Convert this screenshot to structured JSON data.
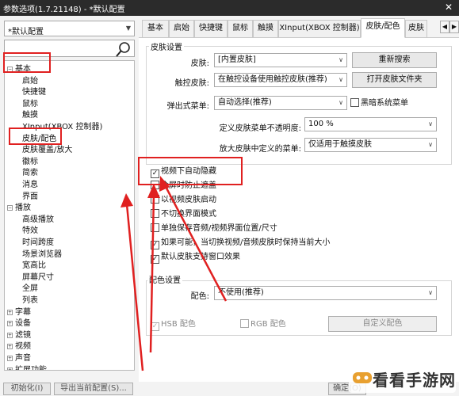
{
  "window": {
    "title": "参数选项(1.7.21148) - *默认配置",
    "close": "✕"
  },
  "left": {
    "profile": "*默认配置",
    "tree": [
      {
        "label": "基本",
        "level": 0,
        "toggle": "−"
      },
      {
        "label": "启始",
        "level": 1
      },
      {
        "label": "快捷键",
        "level": 1
      },
      {
        "label": "鼠标",
        "level": 1
      },
      {
        "label": "触摸",
        "level": 1
      },
      {
        "label": "XInput(XBOX 控制器)",
        "level": 1
      },
      {
        "label": "皮肤/配色",
        "level": 1
      },
      {
        "label": "皮肤覆盖/放大",
        "level": 1
      },
      {
        "label": "徽标",
        "level": 1
      },
      {
        "label": "简索",
        "level": 1
      },
      {
        "label": "消息",
        "level": 1
      },
      {
        "label": "界面",
        "level": 1
      },
      {
        "label": "播放",
        "level": 0,
        "toggle": "−"
      },
      {
        "label": "高级播放",
        "level": 1
      },
      {
        "label": "特效",
        "level": 1
      },
      {
        "label": "时间跨度",
        "level": 1
      },
      {
        "label": "场景浏览器",
        "level": 1
      },
      {
        "label": "宽高比",
        "level": 1
      },
      {
        "label": "屏幕尺寸",
        "level": 1
      },
      {
        "label": "全屏",
        "level": 1
      },
      {
        "label": "列表",
        "level": 1
      },
      {
        "label": "字幕",
        "level": 0,
        "toggle": "+"
      },
      {
        "label": "设备",
        "level": 0,
        "toggle": "+"
      },
      {
        "label": "滤镜",
        "level": 0,
        "toggle": "+"
      },
      {
        "label": "视频",
        "level": 0,
        "toggle": "+"
      },
      {
        "label": "声音",
        "level": 0,
        "toggle": "+"
      },
      {
        "label": "扩展功能",
        "level": 0,
        "toggle": "+"
      }
    ]
  },
  "tabs": [
    "基本",
    "启始",
    "快捷键",
    "鼠标",
    "触摸",
    "XInput(XBOX 控制器)",
    "皮肤/配色",
    "皮肤"
  ],
  "active_tab": 6,
  "skin": {
    "group": "皮肤设置",
    "skin_label": "皮肤:",
    "skin_value": "[内置皮肤]",
    "rescan": "重新搜索",
    "touch_label": "触控皮肤:",
    "touch_value": "在触控设备使用触控皮肤(推荐)",
    "open_folder": "打开皮肤文件夹",
    "popup_label": "弹出式菜单:",
    "popup_value": "自动选择(推荐)",
    "black_menu": "黑暗系统菜单",
    "opacity_label": "定义皮肤菜单不透明度:",
    "opacity_value": "100 %",
    "zoom_label": "放大皮肤中定义的菜单:",
    "zoom_value": "仅适用于触摸皮肤"
  },
  "checks": [
    {
      "label": "视频下自动隐藏",
      "checked": true
    },
    {
      "label": "全屏时防止遮盖",
      "checked": false
    },
    {
      "label": "以视频皮肤启动",
      "checked": false
    },
    {
      "label": "不切换界面模式",
      "checked": false
    },
    {
      "label": "单独保存音频/视频界面位置/尺寸",
      "checked": false
    },
    {
      "label": "如果可能，当切换视频/音频皮肤时保持当前大小",
      "checked": true
    },
    {
      "label": "默认皮肤支持窗口效果",
      "checked": true
    }
  ],
  "color": {
    "group": "配色设置",
    "color_label": "配色:",
    "color_value": "不使用(推荐)",
    "hsb": "HSB 配色",
    "rgb": "RGB 配色",
    "custom": "自定义配色"
  },
  "bottom": {
    "init": "初始化(I)",
    "export": "导出当前配置(S)...",
    "ok": "确定(O)"
  },
  "watermark": "看看手游网",
  "colors": {
    "highlight": "#e02020",
    "titlebar": "#2b2b2b"
  }
}
